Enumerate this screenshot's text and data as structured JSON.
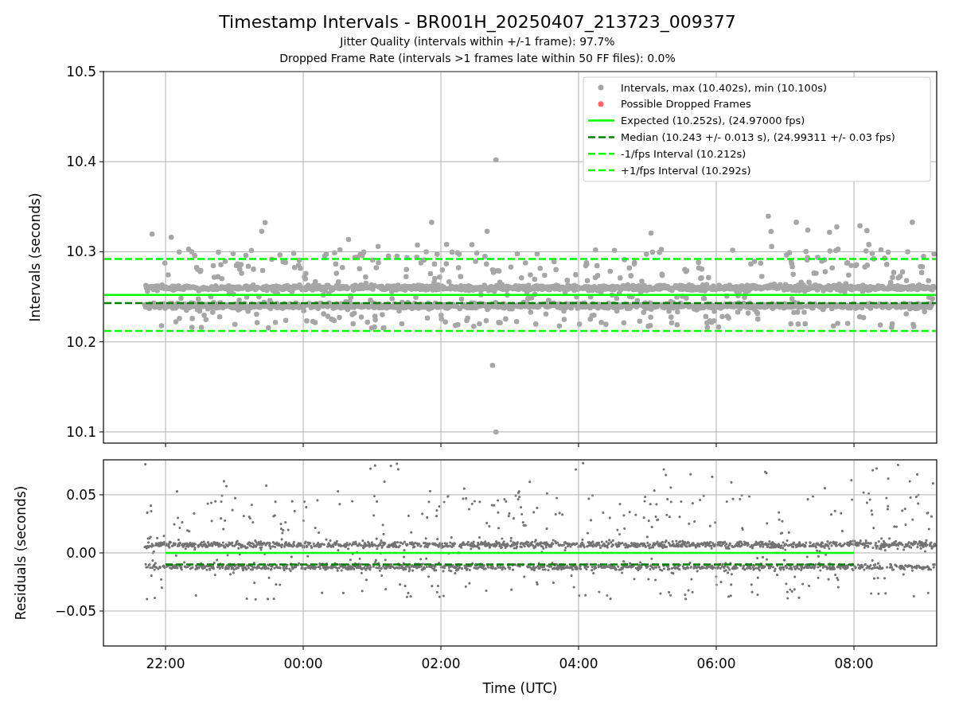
{
  "figure": {
    "title": "Timestamp Intervals - BR001H_20250407_213723_009377",
    "subtitles": [
      "Jitter Quality (intervals within +/-1 frame): 97.7%",
      "Dropped Frame Rate (intervals >1 frames late within 50 FF files): 0.0%"
    ]
  },
  "top_plot": {
    "chart_data": {
      "type": "line",
      "ylabel": "Intervals (seconds)",
      "categories": [
        null,
        null,
        null,
        null,
        null,
        null
      ],
      "ylim": [
        10.0876,
        10.5
      ],
      "grid": true,
      "legend": "upper right",
      "yticks": [
        {
          "value": 10.1,
          "label": "10.1"
        },
        {
          "value": 10.2,
          "label": "10.2"
        },
        {
          "value": 10.3,
          "label": "10.3"
        },
        {
          "value": 10.4,
          "label": "10.4"
        },
        {
          "value": 10.5,
          "label": "10.5"
        }
      ],
      "series": [
        {
          "name": "Expected (10.252s), (24.97000 fps)",
          "color": "#00ff00",
          "line_style": "solid",
          "values": [
            10.252,
            10.252,
            10.252,
            10.252,
            10.252,
            10.252
          ]
        },
        {
          "name": "Median (10.243 +/- 0.013 s), (24.99311 +/- 0.03 fps)",
          "color": "#008000",
          "line_style": "dashed",
          "values": [
            10.243,
            10.243,
            10.243,
            10.243,
            10.243,
            10.243
          ]
        },
        {
          "name": "-1/fps Interval (10.212s)",
          "color": "#00ff00",
          "line_style": "dashed",
          "values": [
            10.212,
            10.212,
            10.212,
            10.212,
            10.212,
            10.212
          ]
        },
        {
          "name": "+1/fps Interval (10.292s)",
          "color": "#00ff00",
          "line_style": "dashed",
          "values": [
            10.292,
            10.292,
            10.292,
            10.292,
            10.292,
            10.292
          ]
        }
      ]
    },
    "point_legend": [
      {
        "label": "Intervals, max (10.402s), min (10.100s)",
        "color": "#a6a6a6"
      },
      {
        "label": "Possible Dropped Frames",
        "color": "#ff6666"
      }
    ]
  },
  "bottom_plot": {
    "chart_data": {
      "type": "line",
      "xlabel": "Time (UTC)",
      "ylabel": "Residuals (seconds)",
      "categories": [
        "22:00",
        "00:00",
        "02:00",
        "04:00",
        "06:00",
        "08:00"
      ],
      "ylim": [
        -0.0801,
        0.0801
      ],
      "grid": true,
      "yticks": [
        {
          "value": -0.05,
          "label": "−0.05"
        },
        {
          "value": 0,
          "label": "0.00"
        },
        {
          "value": 0.05,
          "label": "0.05"
        }
      ],
      "series": [
        {
          "color": "#00ff00",
          "line_style": "solid",
          "values": [
            0,
            0,
            0,
            0,
            0,
            0
          ]
        },
        {
          "color": "#008000",
          "line_style": "dashed",
          "values": [
            -0.01,
            -0.01,
            -0.01,
            -0.01,
            -0.01,
            -0.01
          ]
        }
      ]
    }
  }
}
